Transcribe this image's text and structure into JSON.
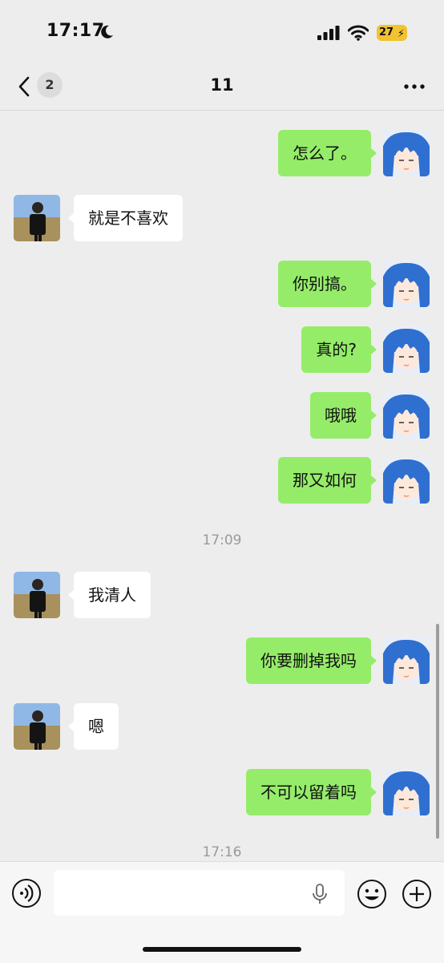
{
  "status_bar": {
    "time": "17:17",
    "battery_level": "27",
    "icons": [
      "moon-icon",
      "signal-icon",
      "wifi-icon",
      "battery-icon"
    ]
  },
  "nav": {
    "unread_count": "2",
    "title": "11",
    "icons": [
      "back-icon",
      "more-icon"
    ]
  },
  "colors": {
    "outgoing_bubble": "#95ec69",
    "incoming_bubble": "#ffffff",
    "background": "#ededed",
    "battery": "#f2c230"
  },
  "messages": [
    {
      "side": "out",
      "text": "怎么了。"
    },
    {
      "side": "in",
      "text": "就是不喜欢"
    },
    {
      "side": "out",
      "text": "你别搞。"
    },
    {
      "side": "out",
      "text": "真的?"
    },
    {
      "side": "out",
      "text": "哦哦"
    },
    {
      "side": "out",
      "text": "那又如何"
    },
    {
      "side": "time",
      "text": "17:09"
    },
    {
      "side": "in",
      "text": "我清人"
    },
    {
      "side": "out",
      "text": "你要删掉我吗"
    },
    {
      "side": "in",
      "text": "嗯"
    },
    {
      "side": "out",
      "text": "不可以留着吗"
    },
    {
      "side": "time",
      "text": "17:16"
    }
  ],
  "input_bar": {
    "value": "",
    "icons": [
      "voice-icon",
      "microphone-icon",
      "emoji-icon",
      "plus-icon"
    ]
  }
}
